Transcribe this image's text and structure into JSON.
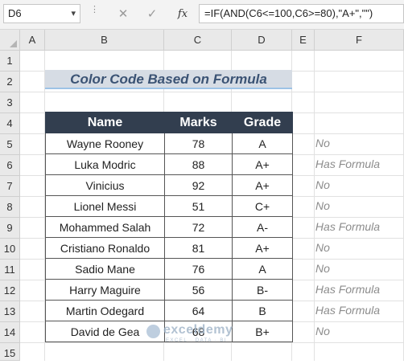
{
  "formula_bar": {
    "name_box": "D6",
    "name_box_dropdown_icon": "chevron-down-icon",
    "cancel_icon": "close-icon",
    "enter_icon": "check-icon",
    "fx_label": "fx",
    "formula": "=IF(AND(C6<=100,C6>=80),\"A+\",\"\")"
  },
  "columns": [
    "A",
    "B",
    "C",
    "D",
    "E",
    "F"
  ],
  "rows": [
    "1",
    "2",
    "3",
    "4",
    "5",
    "6",
    "7",
    "8",
    "9",
    "10",
    "11",
    "12",
    "13",
    "14",
    "15"
  ],
  "sheet": {
    "title": "Color Code Based on Formula",
    "table": {
      "headers": [
        "Name",
        "Marks",
        "Grade"
      ],
      "rows": [
        {
          "name": "Wayne Rooney",
          "marks": "78",
          "grade": "A"
        },
        {
          "name": "Luka Modric",
          "marks": "88",
          "grade": "A+"
        },
        {
          "name": "Vinicius",
          "marks": "92",
          "grade": "A+"
        },
        {
          "name": "Lionel Messi",
          "marks": "51",
          "grade": "C+"
        },
        {
          "name": "Mohammed Salah",
          "marks": "72",
          "grade": "A-"
        },
        {
          "name": "Cristiano Ronaldo",
          "marks": "81",
          "grade": "A+"
        },
        {
          "name": "Sadio Mane",
          "marks": "76",
          "grade": "A"
        },
        {
          "name": "Harry Maguire",
          "marks": "56",
          "grade": "B-"
        },
        {
          "name": "Martin Odegard",
          "marks": "64",
          "grade": "B"
        },
        {
          "name": "David de Gea",
          "marks": "68",
          "grade": "B+"
        }
      ]
    },
    "column_f": [
      "No",
      "Has Formula",
      "No",
      "No",
      "Has Formula",
      "No",
      "No",
      "Has Formula",
      "Has Formula",
      "No"
    ]
  },
  "watermark": {
    "brand": "exceldemy",
    "tagline": "EXCEL · DATA · BI"
  },
  "colors": {
    "header_fill": "#323e4f",
    "title_fill": "#d6dce4",
    "title_text": "#3b5374",
    "title_underline": "#9dc3e6",
    "column_f_text": "#8c8c8c"
  }
}
